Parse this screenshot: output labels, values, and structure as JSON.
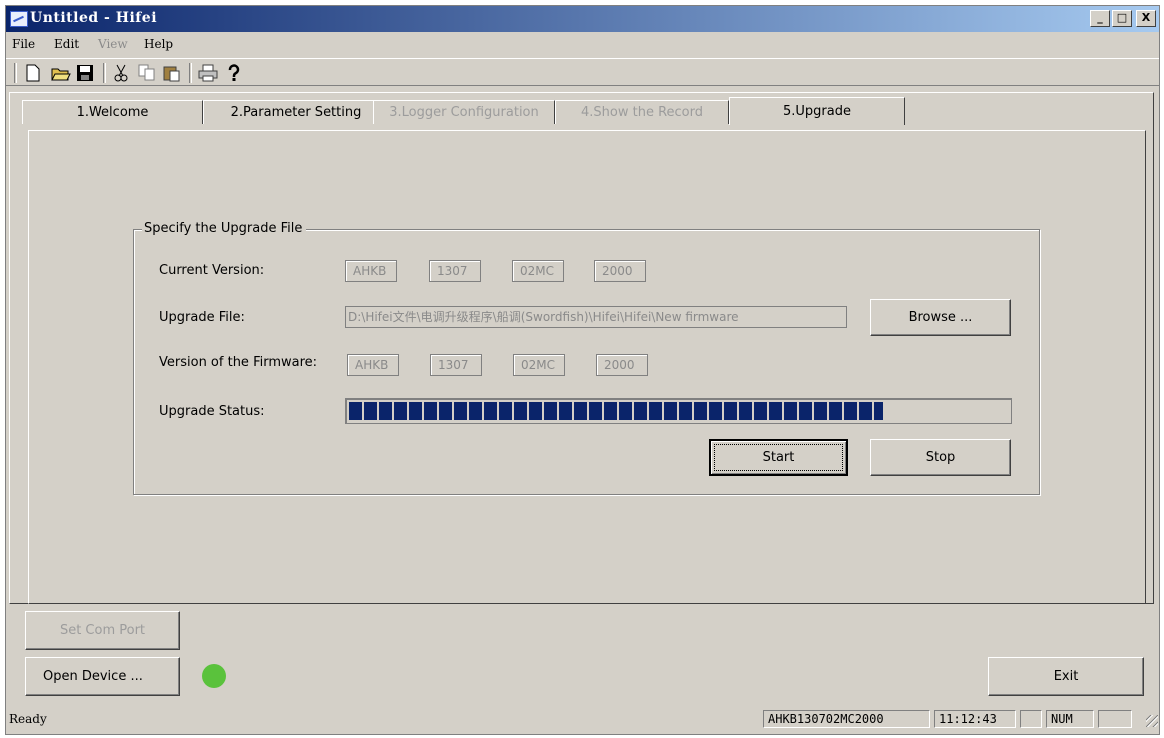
{
  "window": {
    "title": "Untitled - Hifei",
    "min_label": "_",
    "max_label": "□",
    "close_label": "X"
  },
  "menu": [
    {
      "label": "File",
      "enabled": true
    },
    {
      "label": "Edit",
      "enabled": true
    },
    {
      "label": "View",
      "enabled": false
    },
    {
      "label": "Help",
      "enabled": true
    }
  ],
  "toolbar": {
    "icons": [
      "new-icon",
      "open-icon",
      "save-icon",
      "cut-icon",
      "copy-icon",
      "paste-icon",
      "print-icon",
      "help-icon"
    ]
  },
  "tabs": [
    {
      "label": "1.Welcome",
      "enabled": true
    },
    {
      "label": "2.Parameter Setting",
      "enabled": true
    },
    {
      "label": "3.Logger Configuration",
      "enabled": false
    },
    {
      "label": "4.Show the Record",
      "enabled": false
    },
    {
      "label": "5.Upgrade",
      "enabled": true,
      "active": true
    }
  ],
  "upgrade": {
    "group_title": "Specify the Upgrade File",
    "current_version_label": "Current Version:",
    "current_version": [
      "AHKB",
      "1307",
      "02MC",
      "2000"
    ],
    "upgrade_file_label": "Upgrade File:",
    "upgrade_file_path": "D:\\Hifei文件\\电调升级程序\\船调(Swordfish)\\Hifei\\Hifei\\New firmware",
    "browse_label": "Browse ...",
    "firmware_version_label": "Version of the Firmware:",
    "firmware_version": [
      "AHKB",
      "1307",
      "02MC",
      "2000"
    ],
    "status_label": "Upgrade Status:",
    "progress_fraction": 0.81,
    "start_label": "Start",
    "stop_label": "Stop"
  },
  "bottom": {
    "set_com_port_label": "Set Com Port",
    "open_device_label": "Open Device ...",
    "device_led_color": "#5ac23c",
    "exit_label": "Exit"
  },
  "statusbar": {
    "ready": "Ready",
    "device_id": "AHKB130702MC2000",
    "time": "11:12:43",
    "num": "NUM"
  },
  "colors": {
    "accent": "#0a246a",
    "face": "#d4d0c8"
  }
}
